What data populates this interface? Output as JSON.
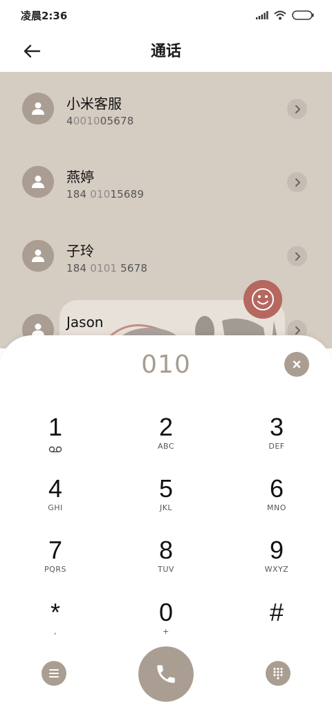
{
  "status_bar": {
    "time": "凌晨2:36"
  },
  "header": {
    "title": "通话"
  },
  "contacts": [
    {
      "name": "小米客服",
      "number_pre": "4",
      "number_hl": "0010",
      "number_post": "05678"
    },
    {
      "name": "燕婷",
      "number_pre": "184 ",
      "number_hl": "010",
      "number_post": "15689"
    },
    {
      "name": "子玲",
      "number_pre": "184 ",
      "number_hl": "0101",
      "number_post": " 5678"
    },
    {
      "name": "Jason"
    }
  ],
  "dialer": {
    "input": "010",
    "keys": [
      {
        "num": "1",
        "letters": ""
      },
      {
        "num": "2",
        "letters": "ABC"
      },
      {
        "num": "3",
        "letters": "DEF"
      },
      {
        "num": "4",
        "letters": "GHI"
      },
      {
        "num": "5",
        "letters": "JKL"
      },
      {
        "num": "6",
        "letters": "MNO"
      },
      {
        "num": "7",
        "letters": "PQRS"
      },
      {
        "num": "8",
        "letters": "TUV"
      },
      {
        "num": "9",
        "letters": "WXYZ"
      },
      {
        "num": "*",
        "letters": ","
      },
      {
        "num": "0",
        "letters": "+"
      },
      {
        "num": "#",
        "letters": ""
      }
    ]
  },
  "icons": {
    "back": "arrow-left-icon",
    "avatar": "person-icon",
    "chevron": "chevron-right-icon",
    "smiley": "smiley-icon",
    "clear": "close-icon",
    "voicemail": "voicemail-icon",
    "menu": "menu-icon",
    "call": "phone-icon",
    "keypad": "keypad-icon"
  },
  "colors": {
    "accent": "#aa9e92",
    "list_bg": "#d5ccc2",
    "smiley_bg": "#b5685f",
    "digits": "#a89d91"
  }
}
